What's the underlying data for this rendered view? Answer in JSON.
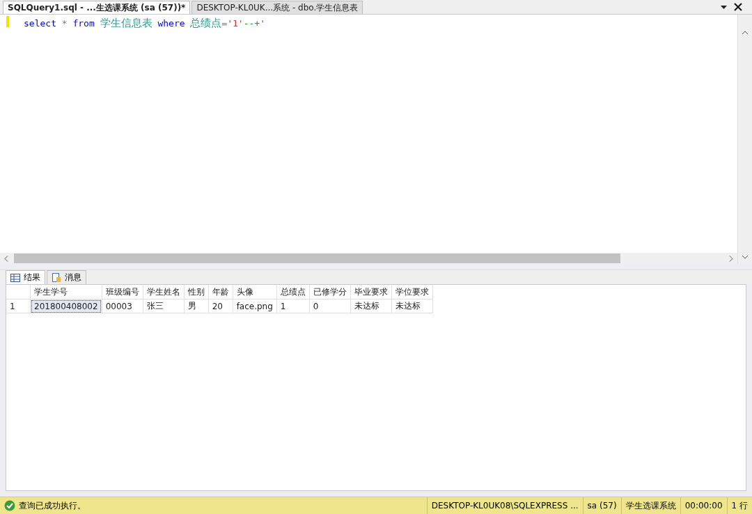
{
  "tabs": [
    {
      "label": "SQLQuery1.sql - ...生选课系统 (sa (57))*",
      "selected": true
    },
    {
      "label": "DESKTOP-KL0UK...系统 - dbo.学生信息表",
      "selected": false
    }
  ],
  "editor": {
    "tokens": [
      {
        "kind": "keyword",
        "text": "select"
      },
      {
        "kind": "operator",
        "text": "*"
      },
      {
        "kind": "keyword",
        "text": "from"
      },
      {
        "kind": "identifier",
        "text": "学生信息表"
      },
      {
        "kind": "keyword",
        "text": "where"
      },
      {
        "kind": "identifier",
        "text": "总绩点"
      },
      {
        "kind": "operator",
        "text": "=",
        "join": true
      },
      {
        "kind": "string",
        "text": "'1'",
        "join": true
      },
      {
        "kind": "comment",
        "text": "--+'",
        "join": true
      }
    ]
  },
  "result_tabs": [
    {
      "label": "结果",
      "kind": "grid",
      "selected": true
    },
    {
      "label": "消息",
      "kind": "messages",
      "selected": false
    }
  ],
  "table": {
    "columns": [
      "学生学号",
      "班级编号",
      "学生姓名",
      "性别",
      "年龄",
      "头像",
      "总绩点",
      "已修学分",
      "毕业要求",
      "学位要求"
    ],
    "rows": [
      {
        "number": "1",
        "cells": [
          "201800408002",
          "00003",
          "张三",
          "男",
          "20",
          "face.png",
          "1",
          "0",
          "未达标",
          "未达标"
        ]
      }
    ]
  },
  "status_bar": {
    "message": "查询已成功执行。",
    "fields": [
      "DESKTOP-KL0UK08\\SQLEXPRESS ...",
      "sa (57)",
      "学生选课系统",
      "00:00:00",
      "1 行"
    ]
  }
}
